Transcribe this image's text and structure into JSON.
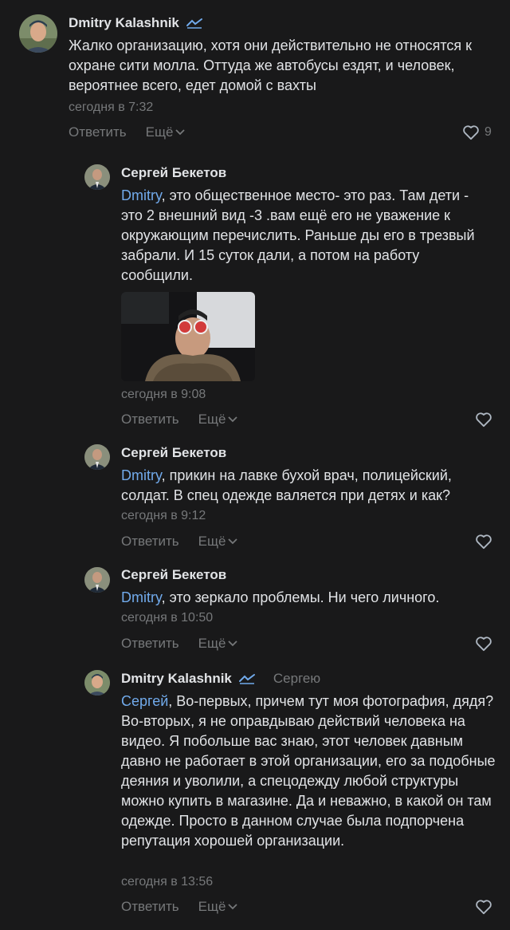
{
  "comments": [
    {
      "author": "Dmitry Kalashnik",
      "text": "Жалко организацию, хотя они действительно не относятся к охране сити молла. Оттуда же автобусы ездят, и человек, вероятнее всего, едет домой с вахты",
      "time": "сегодня в 7:32",
      "reply_label": "Ответить",
      "more_label": "Ещё",
      "likes": "9"
    },
    {
      "author": "Сергей Бекетов",
      "mention": "Dmitry",
      "text": ", это общественное место- это раз. Там дети - это 2 внешний вид -3 .вам ещё его не уважение к окружающим перечислить. Раньше ды его в трезвый забрали. И 15 суток дали, а потом на работу сообщили.",
      "time": "сегодня в 9:08",
      "reply_label": "Ответить",
      "more_label": "Ещё"
    },
    {
      "author": "Сергей Бекетов",
      "mention": "Dmitry",
      "text": ", прикин на лавке бухой врач, полицейский, солдат. В спец одежде валяется при детях и как?",
      "time": "сегодня в 9:12",
      "reply_label": "Ответить",
      "more_label": "Ещё"
    },
    {
      "author": "Сергей Бекетов",
      "mention": "Dmitry",
      "text": ", это зеркало проблемы. Ни чего личного.",
      "time": "сегодня в 10:50",
      "reply_label": "Ответить",
      "more_label": "Ещё"
    },
    {
      "author": "Dmitry Kalashnik",
      "reply_to": "Сергею",
      "mention": "Сергей",
      "text": ", Во-первых, причем тут моя фотография, дядя? Во-вторых, я не оправдываю действий человека на видео. Я побольше вас знаю, этот человек давным давно не работает в этой организации, его за подобные деяния и уволили, а спецодежду любой структуры можно купить в магазине. Да и неважно, в какой он там одежде. Просто в данном случае была подпорчена репутация хорошей организации.",
      "time": "сегодня в 13:56",
      "reply_label": "Ответить",
      "more_label": "Ещё"
    }
  ],
  "colors": {
    "background": "#19191a",
    "text": "#e1e3e6",
    "secondary": "#76787a",
    "link": "#71aaeb"
  }
}
